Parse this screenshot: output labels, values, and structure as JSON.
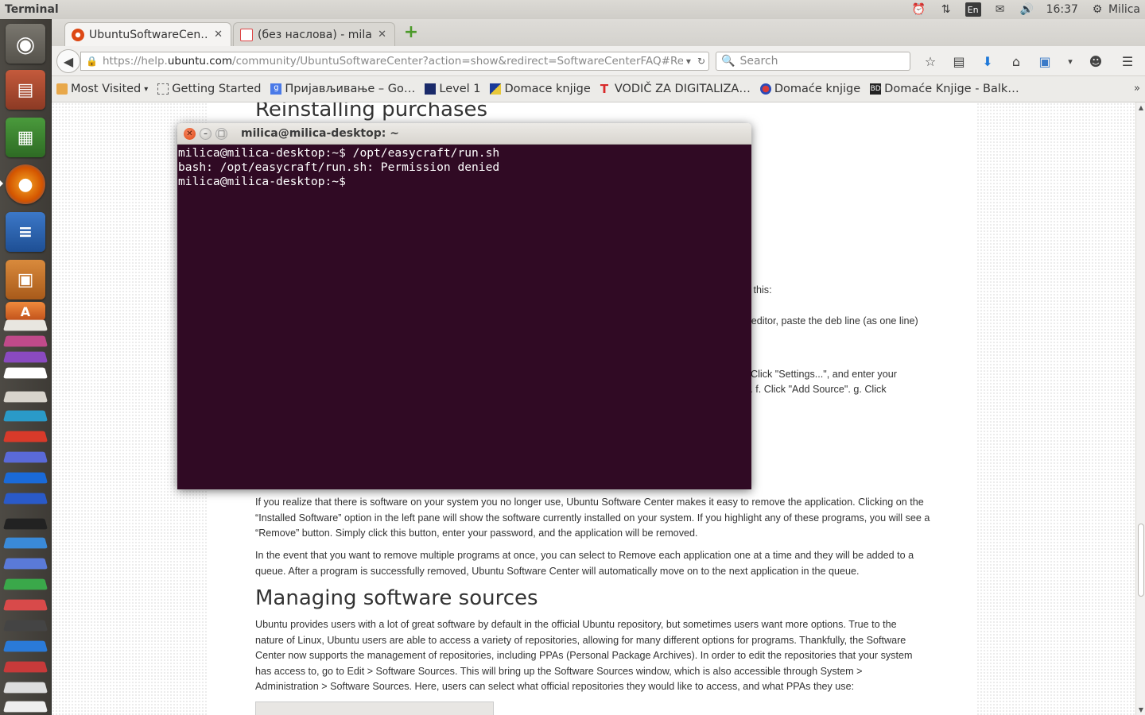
{
  "top_panel": {
    "app_title": "Terminal",
    "language": "En",
    "time": "16:37",
    "user": "Milica"
  },
  "launcher": {
    "items": [
      "ubuntu-dash",
      "files",
      "spreadsheet",
      "firefox",
      "writer",
      "impress",
      "software-center",
      "amazon"
    ]
  },
  "browser": {
    "tabs": [
      {
        "label": "UbuntuSoftwareCen…",
        "active": true
      },
      {
        "label": "(без наслова) - mila…",
        "active": false
      }
    ],
    "url_prefix": "https://help.",
    "url_domain": "ubuntu.com",
    "url_suffix": "/community/UbuntuSoftwareCenter?action=show&redirect=SoftwareCenterFAQ#Re",
    "search_placeholder": "Search",
    "bookmarks": [
      {
        "label": "Most Visited",
        "icon": "folder-icon"
      },
      {
        "label": "Getting Started",
        "icon": "page-icon"
      },
      {
        "label": "Пријављивање – Go…",
        "icon": "google-icon"
      },
      {
        "label": "Level 1",
        "icon": "oup-icon"
      },
      {
        "label": "Domace knjige",
        "icon": "flag-icon"
      },
      {
        "label": "VODIČ ZA DIGITALIZA…",
        "icon": "t-icon"
      },
      {
        "label": "Domaće knjige",
        "icon": "crest-icon"
      },
      {
        "label": "Domaće Knjige - Balk…",
        "icon": "bd-icon"
      }
    ]
  },
  "page": {
    "heading_reinstalling": "Reinstalling purchases",
    "frag1": "o this:",
    "frag2": "r editor, paste the deb line (as one line)",
    "frag3": ". Click \"Settings...\", and enter your",
    "frag4": "x. f. Click \"Add Source\". g. Click",
    "para_remove1": "If you realize that there is software on your system you no longer use, Ubuntu Software Center makes it easy to remove the application. Clicking on the “Installed Software” option in the left pane will show the software currently installed on your system. If you highlight any of these programs, you will see a “Remove” button. Simply click this button, enter your password, and the application will be removed.",
    "para_remove2": "In the event that you want to remove multiple programs at once, you can select to Remove each application one at a time and they will be added to a queue. After a program is successfully removed, Ubuntu Software Center will automatically move on to the next application in the queue.",
    "heading_sources": "Managing software sources",
    "para_sources": "Ubuntu provides users with a lot of great software by default in the official Ubuntu repository, but sometimes users want more options. True to the nature of Linux, Ubuntu users are able to access a variety of repositories, allowing for many different options for programs. Thankfully, the Software Center now supports the management of repositories, including PPAs (Personal Package Archives). In order to edit the repositories that your system has access to, go to Edit > Software Sources. This will bring up the Software Sources window, which is also accessible through System > Administration > Software Sources. Here, users can select what official repositories they would like to access, and what PPAs they use:"
  },
  "terminal": {
    "title": "milica@milica-desktop: ~",
    "lines": [
      "milica@milica-desktop:~$ /opt/easycraft/run.sh",
      "bash: /opt/easycraft/run.sh: Permission denied",
      "milica@milica-desktop:~$ "
    ]
  }
}
